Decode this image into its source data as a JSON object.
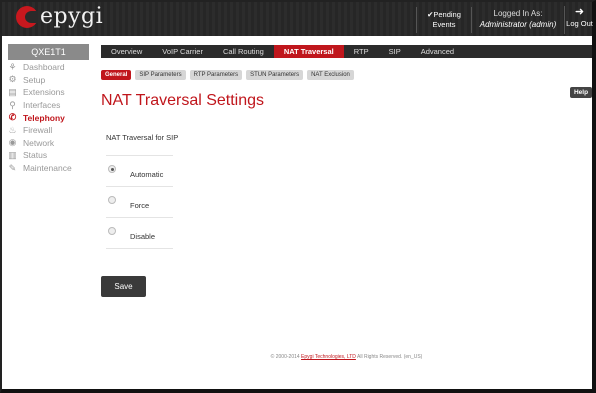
{
  "header": {
    "logo_text": "epygi",
    "pending": {
      "line1": "✔Pending",
      "line2": "Events"
    },
    "logged_in": {
      "line1": "Logged In As:",
      "line2": "Administrator (admin)"
    },
    "logout_label": "Log Out"
  },
  "sidebar": {
    "device": "QXE1T1",
    "items": [
      {
        "label": "Dashboard",
        "icon": "dashboard-icon",
        "glyph": "⚘"
      },
      {
        "label": "Setup",
        "icon": "gear-icon",
        "glyph": "⚙"
      },
      {
        "label": "Extensions",
        "icon": "extensions-icon",
        "glyph": "▤"
      },
      {
        "label": "Interfaces",
        "icon": "interfaces-icon",
        "glyph": "⚲"
      },
      {
        "label": "Telephony",
        "icon": "phone-icon",
        "glyph": "✆"
      },
      {
        "label": "Firewall",
        "icon": "firewall-icon",
        "glyph": "♨"
      },
      {
        "label": "Network",
        "icon": "network-icon",
        "glyph": "◉"
      },
      {
        "label": "Status",
        "icon": "status-icon",
        "glyph": "▥"
      },
      {
        "label": "Maintenance",
        "icon": "wrench-icon",
        "glyph": "✎"
      }
    ]
  },
  "tabs": [
    "Overview",
    "VoIP Carrier",
    "Call Routing",
    "NAT Traversal",
    "RTP",
    "SIP",
    "Advanced"
  ],
  "subtabs": [
    "General",
    "SIP Parameters",
    "RTP Parameters",
    "STUN Parameters",
    "NAT Exclusion"
  ],
  "page": {
    "title": "NAT Traversal Settings",
    "help": "Help",
    "section_label": "NAT Traversal for SIP",
    "options": [
      {
        "label": "Automatic",
        "selected": true
      },
      {
        "label": "Force",
        "selected": false
      },
      {
        "label": "Disable",
        "selected": false
      }
    ],
    "save_label": "Save"
  },
  "footer": {
    "prefix": "© 2000-2014 ",
    "link": "Epygi Technologies, LTD",
    "suffix": " All Rights Reserved. (en_US)"
  },
  "colors": {
    "accent": "#c0161c",
    "bar": "#2b2b2b"
  }
}
